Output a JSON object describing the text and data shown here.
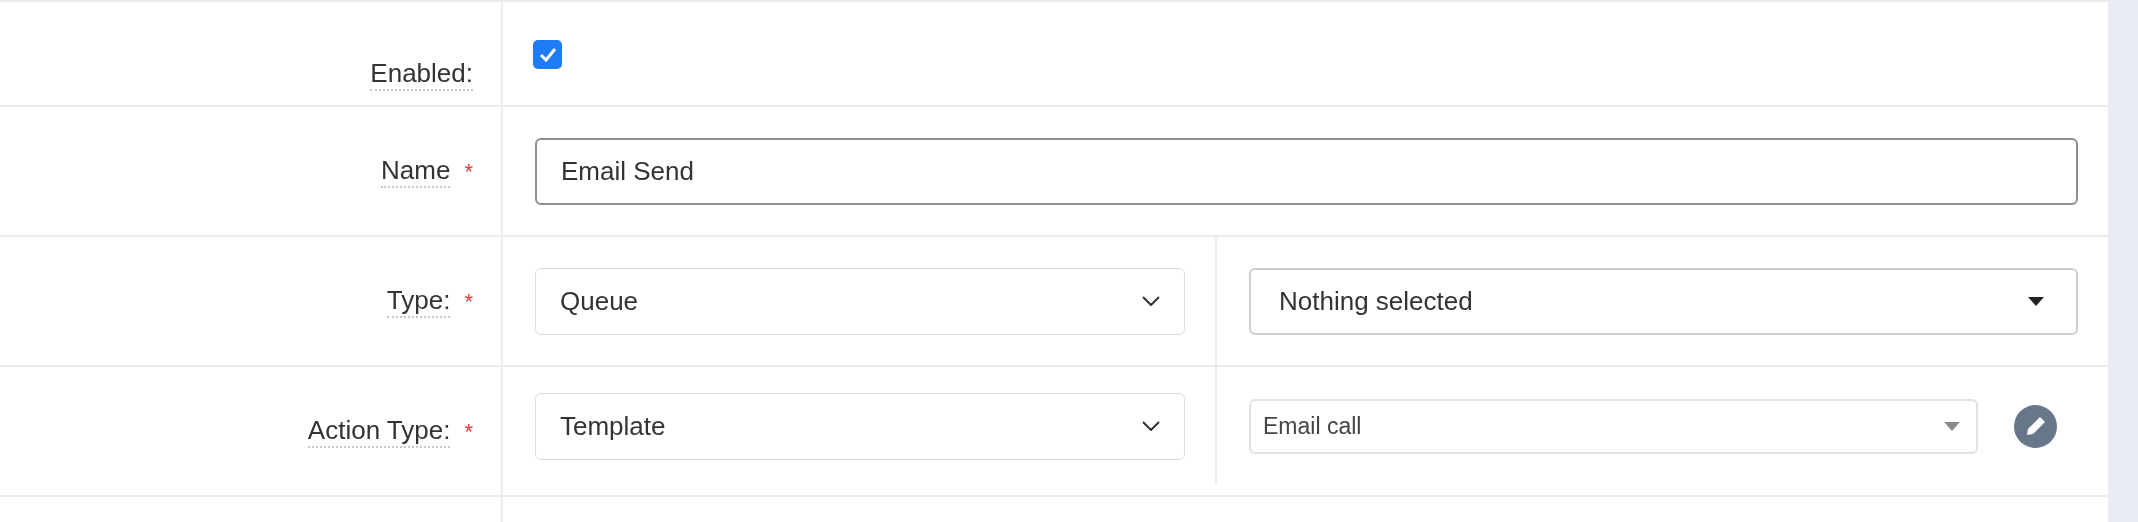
{
  "fields": [
    {
      "kind": "checkbox",
      "label": "Enabled:",
      "checked": true
    },
    {
      "kind": "text",
      "label": "Name",
      "required_mark": "*",
      "value": "Email Send"
    },
    {
      "kind": "select-pair",
      "label": "Type:",
      "required_mark": "*",
      "select": "Queue",
      "picker": "Nothing selected"
    },
    {
      "kind": "select-edit",
      "label": "Action Type:",
      "required_mark": "*",
      "select": "Template",
      "picker": "Email call"
    }
  ]
}
